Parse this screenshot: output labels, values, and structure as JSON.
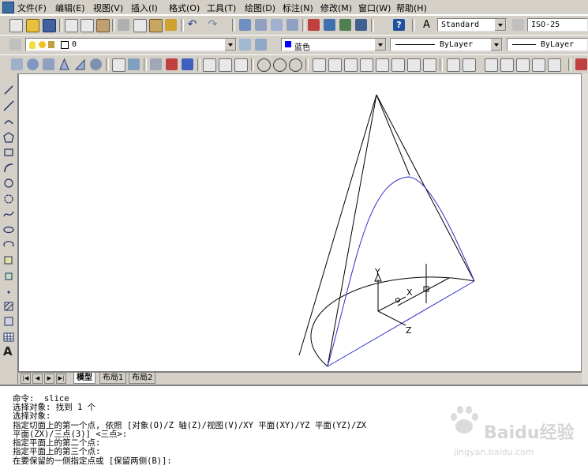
{
  "menu": [
    "文件(F)",
    "编辑(E)",
    "视图(V)",
    "插入(I)",
    "格式(O)",
    "工具(T)",
    "绘图(D)",
    "标注(N)",
    "修改(M)",
    "窗口(W)",
    "帮助(H)"
  ],
  "toolbar": {
    "text_style": "Standard",
    "dim_style": "ISO-25",
    "layer": "0",
    "color": "蓝色",
    "linetype": "ByLayer",
    "lineweight": "ByLayer"
  },
  "colors": {
    "object_color": "#0000ff",
    "slice_color": "#3030c8",
    "canvas": "#ffffff",
    "chrome": "#d4d0c8"
  },
  "ucs": {
    "x": "X",
    "y": "Y",
    "z": "Z"
  },
  "tabs": [
    "模型",
    "布局1",
    "布局2"
  ],
  "nav_glyphs": [
    "|◀",
    "◀",
    "▶",
    "▶|"
  ],
  "command_lines": [
    "命令: _slice",
    "选择对象: 找到 1 个",
    "选择对象:",
    "指定切面上的第一个点, 依照 [对象(O)/Z 轴(Z)/视图(V)/XY 平面(XY)/YZ 平面(YZ)/ZX",
    "平面(ZX)/三点(3)] <三点>:",
    "指定平面上的第二个点:",
    "指定平面上的第三个点:",
    "在要保留的一侧指定点或 [保留两侧(B)]:"
  ],
  "watermark": {
    "brand": "Baidu经验",
    "url": "jingyan.baidu.com"
  },
  "icons": [
    "new-icon",
    "open-icon",
    "save-icon",
    "print-icon",
    "preview-icon",
    "publish-icon",
    "cut-icon",
    "copy-icon",
    "paste-icon",
    "matchprop-icon",
    "undo-icon",
    "redo-icon",
    "pan-icon",
    "zoom-realtime-icon",
    "zoom-window-icon",
    "zoom-previous-icon",
    "properties-icon",
    "designcenter-icon",
    "toolpalette-icon",
    "help-icon"
  ]
}
